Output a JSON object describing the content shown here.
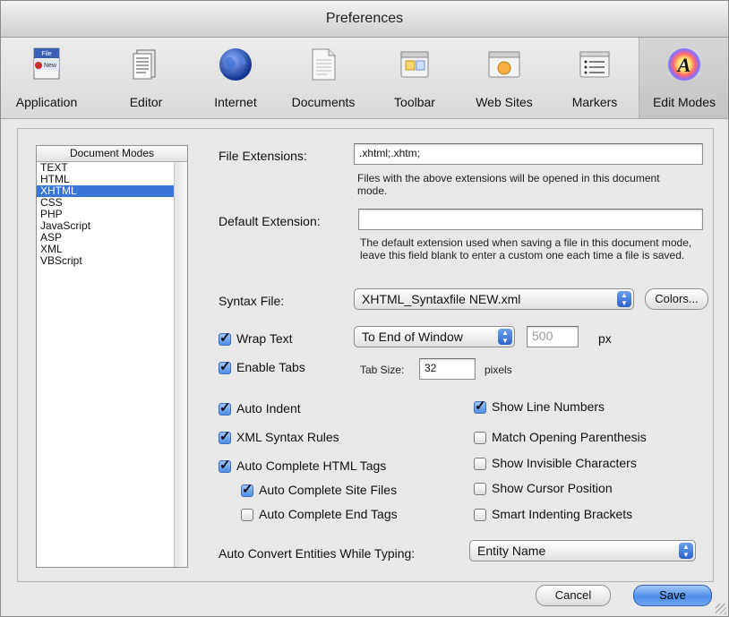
{
  "window": {
    "title": "Preferences"
  },
  "toolbar": {
    "items": [
      {
        "label": "Application",
        "icon": "application-icon"
      },
      {
        "label": "Editor",
        "icon": "editor-icon"
      },
      {
        "label": "Internet",
        "icon": "globe-icon"
      },
      {
        "label": "Documents",
        "icon": "documents-icon"
      },
      {
        "label": "Toolbar",
        "icon": "toolbar-icon"
      },
      {
        "label": "Web Sites",
        "icon": "web-sites-icon"
      },
      {
        "label": "Markers",
        "icon": "markers-icon"
      },
      {
        "label": "Edit Modes",
        "icon": "edit-modes-icon",
        "selected": true
      }
    ],
    "app_icon_text_top": "File",
    "app_icon_text_bottom": "New"
  },
  "modes": {
    "header": "Document Modes",
    "items": [
      "TEXT",
      "HTML",
      "XHTML",
      "CSS",
      "PHP",
      "JavaScript",
      "ASP",
      "XML",
      "VBScript"
    ],
    "selected": "XHTML"
  },
  "file_extensions": {
    "label": "File Extensions:",
    "value": ".xhtml;.xhtm;",
    "help": "Files with the above extensions will be opened in this document mode."
  },
  "default_extension": {
    "label": "Default Extension:",
    "value": "",
    "help": "The default extension used when saving a file in this document mode, leave this field blank to enter a custom one each time a file is saved."
  },
  "syntax": {
    "label": "Syntax File:",
    "value": "XHTML_Syntaxfile NEW.xml",
    "colors_button": "Colors..."
  },
  "wrap": {
    "label": "Wrap Text",
    "checked": true,
    "mode": "To End of Window",
    "width": "500",
    "unit": "px"
  },
  "tabs": {
    "label": "Enable Tabs",
    "checked": true,
    "size_label": "Tab Size:",
    "size": "32",
    "unit": "pixels"
  },
  "options_left": [
    {
      "label": "Auto Indent",
      "checked": true
    },
    {
      "label": "XML Syntax Rules",
      "checked": true
    },
    {
      "label": "Auto Complete HTML Tags",
      "checked": true
    },
    {
      "label": "Auto Complete Site Files",
      "checked": true
    },
    {
      "label": "Auto Complete End Tags",
      "checked": false
    }
  ],
  "options_right": [
    {
      "label": "Show Line Numbers",
      "checked": true
    },
    {
      "label": "Match Opening Parenthesis",
      "checked": false
    },
    {
      "label": "Show Invisible Characters",
      "checked": false
    },
    {
      "label": "Show Cursor Position",
      "checked": false
    },
    {
      "label": "Smart Indenting Brackets",
      "checked": false
    }
  ],
  "entities": {
    "label": "Auto Convert Entities While Typing:",
    "value": "Entity Name"
  },
  "buttons": {
    "cancel": "Cancel",
    "save": "Save"
  },
  "colors": {
    "selection": "#3875d7",
    "accent": "#4d8ee8"
  }
}
